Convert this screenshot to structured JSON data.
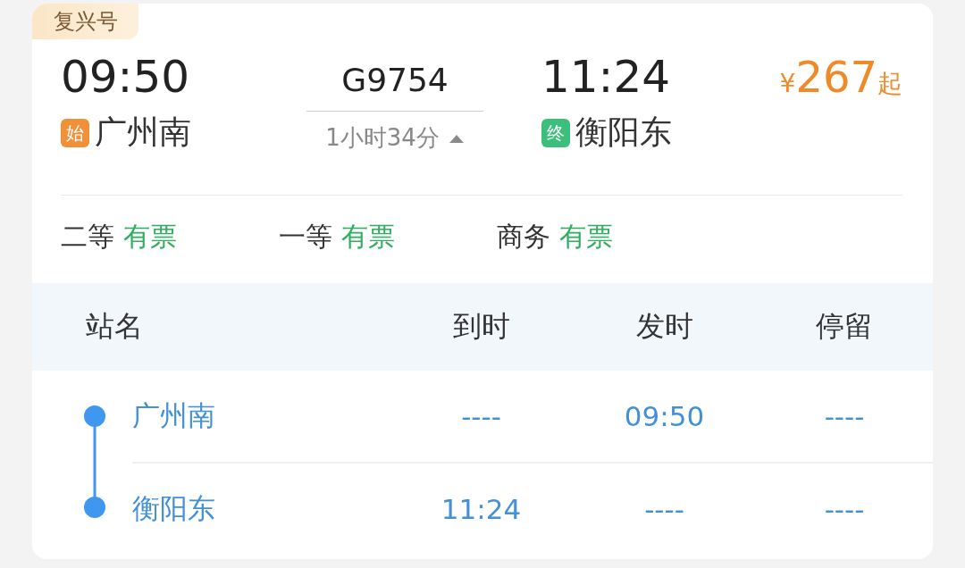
{
  "train_type": "复兴号",
  "depart": {
    "time": "09:50",
    "station": "广州南",
    "tag": "始",
    "kind": "start"
  },
  "train": {
    "number": "G9754",
    "duration": "1小时34分"
  },
  "arrive": {
    "time": "11:24",
    "station": "衡阳东",
    "tag": "终",
    "kind": "end"
  },
  "price": {
    "currency": "¥",
    "amount": "267",
    "suffix": "起"
  },
  "seats": [
    {
      "class": "二等",
      "status": "有票"
    },
    {
      "class": "一等",
      "status": "有票"
    },
    {
      "class": "商务",
      "status": "有票"
    }
  ],
  "table": {
    "columns": [
      "站名",
      "到时",
      "发时",
      "停留"
    ],
    "rows": [
      [
        "广州南",
        "----",
        "09:50",
        "----"
      ],
      [
        "衡阳东",
        "11:24",
        "----",
        "----"
      ]
    ]
  }
}
